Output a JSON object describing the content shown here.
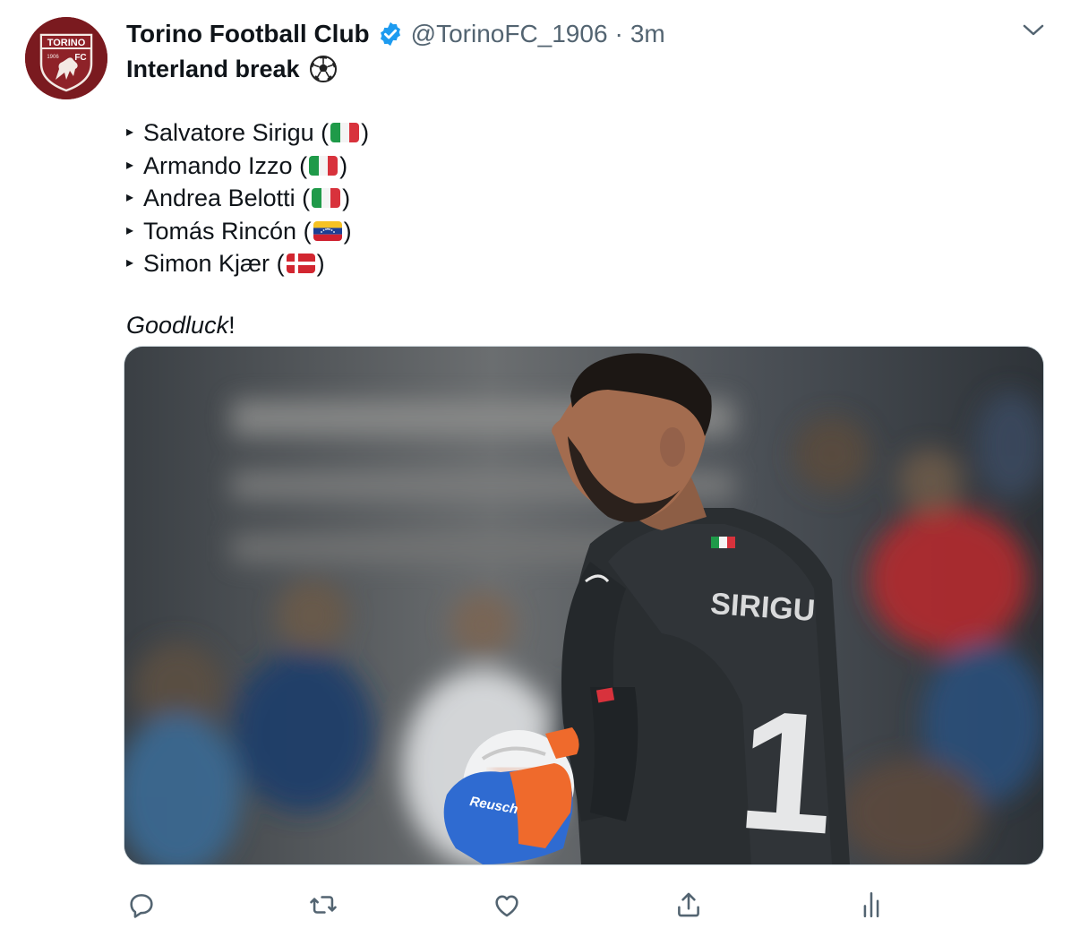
{
  "author": {
    "display_name": "Torino Football Club",
    "handle": "@TorinoFC_1906",
    "separator": "·",
    "time": "3m",
    "avatar_text": "TORINO",
    "avatar_year": "1906",
    "avatar_fc": "FC",
    "verified": true
  },
  "tweet": {
    "title": "Interland break",
    "players": [
      {
        "name": "Salvatore Sirigu",
        "flag": "italy-flag"
      },
      {
        "name": "Armando Izzo",
        "flag": "italy-flag"
      },
      {
        "name": "Andrea Belotti",
        "flag": "italy-flag"
      },
      {
        "name": "Tomás Rincón",
        "flag": "venezuela-flag"
      },
      {
        "name": "Simon Kjær",
        "flag": "denmark-flag"
      }
    ],
    "bullet": "▸",
    "open_paren": "(",
    "close_paren": ")",
    "closing_italic": "Goodluck",
    "closing_suffix": "!"
  },
  "media": {
    "jersey_name": "SIRIGU",
    "jersey_number": "1",
    "glove_brand": "Reusch"
  },
  "actions": [
    "reply-icon",
    "retweet-icon",
    "like-icon",
    "share-icon",
    "analytics-icon"
  ],
  "colors": {
    "brand": "#7a1a1f",
    "verified": "#1d9bf0",
    "secondary_text": "#536471",
    "icon": "#536471"
  }
}
